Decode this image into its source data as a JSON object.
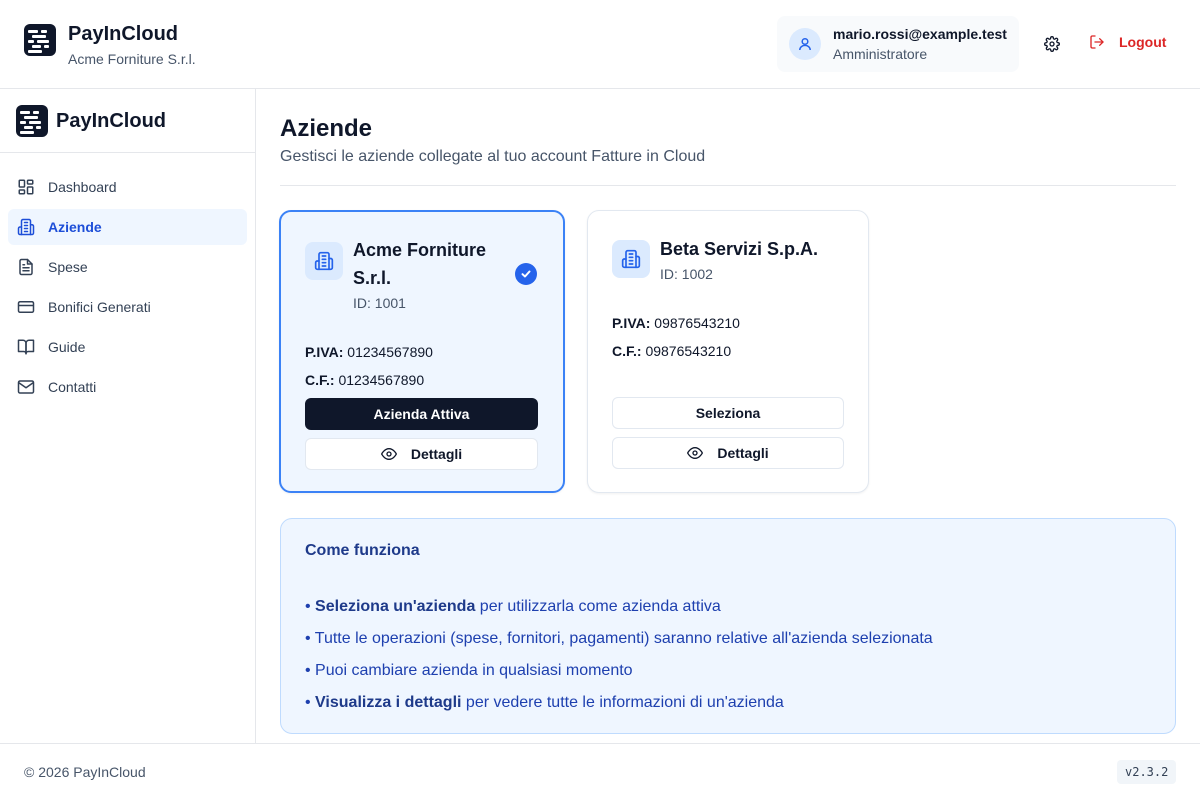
{
  "app": {
    "name": "PayInCloud",
    "company": "Acme Forniture S.r.l."
  },
  "user": {
    "email": "mario.rossi@example.test",
    "role": "Amministratore",
    "logout_label": "Logout"
  },
  "sidebar": {
    "brand": "PayInCloud",
    "items": [
      {
        "label": "Dashboard",
        "icon": "dashboard-icon"
      },
      {
        "label": "Aziende",
        "icon": "building-icon",
        "active": true
      },
      {
        "label": "Spese",
        "icon": "document-icon"
      },
      {
        "label": "Bonifici Generati",
        "icon": "credit-card-icon"
      },
      {
        "label": "Guide",
        "icon": "book-icon"
      },
      {
        "label": "Contatti",
        "icon": "mail-icon"
      }
    ]
  },
  "page": {
    "title": "Aziende",
    "subtitle": "Gestisci le aziende collegate al tuo account Fatture in Cloud"
  },
  "companies": [
    {
      "name_line1": "Acme Forniture",
      "name_line2": "S.r.l.",
      "id_label": "ID: 1001",
      "piva_label": "P.IVA:",
      "piva": "01234567890",
      "cf_label": "C.F.:",
      "cf": "01234567890",
      "primary_button": "Azienda Attiva",
      "details_button": "Dettagli",
      "active": true
    },
    {
      "name": "Beta Servizi S.p.A.",
      "id_label": "ID: 1002",
      "piva_label": "P.IVA:",
      "piva": "09876543210",
      "cf_label": "C.F.:",
      "cf": "09876543210",
      "primary_button": "Seleziona",
      "details_button": "Dettagli",
      "active": false
    }
  ],
  "info": {
    "title": "Come funziona",
    "items": [
      {
        "bold": "Seleziona un'azienda",
        "text": " per utilizzarla come azienda attiva"
      },
      {
        "bold": "",
        "text": "Tutte le operazioni (spese, fornitori, pagamenti) saranno relative all'azienda selezionata"
      },
      {
        "bold": "",
        "text": "Puoi cambiare azienda in qualsiasi momento"
      },
      {
        "bold": "Visualizza i dettagli",
        "text": " per vedere tutte le informazioni di un'azienda"
      }
    ]
  },
  "footer": {
    "copyright": "© 2026 PayInCloud",
    "version": "v2.3.2"
  },
  "colors": {
    "accent": "#2563eb",
    "active_bg": "#eff6ff",
    "logout": "#dc2626",
    "dark_button": "#0f172a"
  }
}
